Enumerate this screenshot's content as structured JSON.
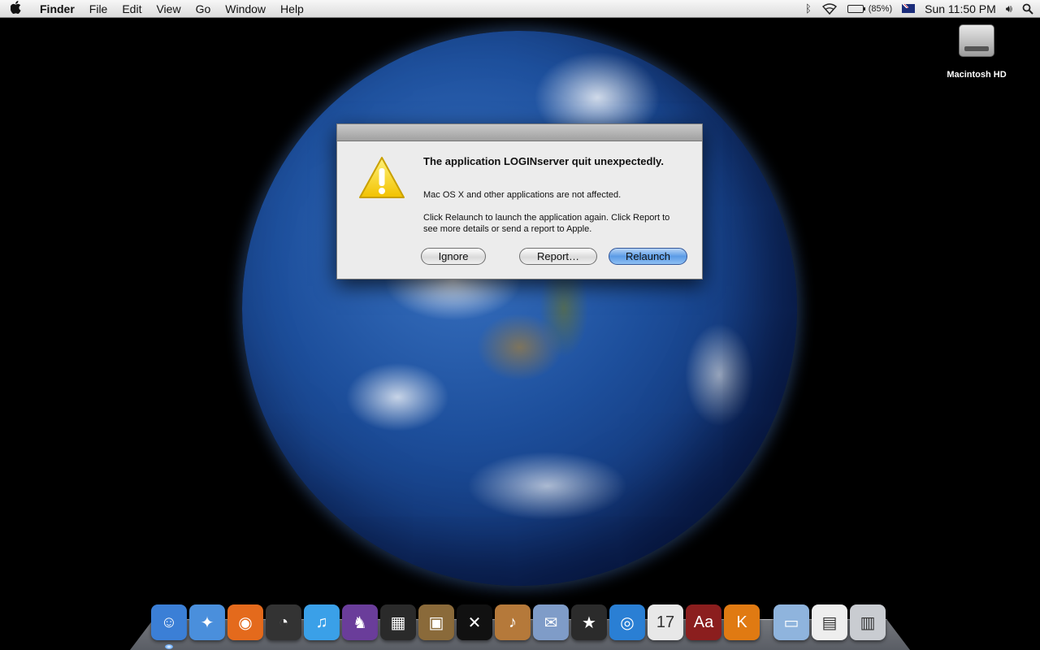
{
  "menubar": {
    "apple_icon": "apple-icon",
    "app_name": "Finder",
    "items": [
      "File",
      "Edit",
      "View",
      "Go",
      "Window",
      "Help"
    ],
    "battery_text": "(85%)",
    "battery_level": 0.85,
    "clock": "Sun 11:50 PM"
  },
  "desktop": {
    "hd_label": "Macintosh HD"
  },
  "dialog": {
    "title": "The application LOGINserver quit unexpectedly.",
    "message1": "Mac OS X and other applications are not affected.",
    "message2": "Click Relaunch to launch the application again. Click Report to see more details or send a report to Apple.",
    "ignore_label": "Ignore",
    "report_label": "Report…",
    "relaunch_label": "Relaunch"
  },
  "dock": {
    "items": [
      {
        "name": "finder-icon",
        "color": "#3b7fd6",
        "glyph": "☺"
      },
      {
        "name": "safari-icon",
        "color": "#4a8fdc",
        "glyph": "✦"
      },
      {
        "name": "firefox-icon",
        "color": "#e46a1c",
        "glyph": "◉"
      },
      {
        "name": "dashboard-icon",
        "color": "#333333",
        "glyph": "◔"
      },
      {
        "name": "itunes-icon",
        "color": "#3aa0e8",
        "glyph": "♫"
      },
      {
        "name": "adium-icon",
        "color": "#6a3d9a",
        "glyph": "♞"
      },
      {
        "name": "photo-booth-icon",
        "color": "#2a2a2a",
        "glyph": "▦"
      },
      {
        "name": "iphoto-icon",
        "color": "#8a6a3a",
        "glyph": "▣"
      },
      {
        "name": "front-row-icon",
        "color": "#111111",
        "glyph": "✕"
      },
      {
        "name": "garageband-icon",
        "color": "#b5793a",
        "glyph": "♪"
      },
      {
        "name": "mail-icon",
        "color": "#7f9cc8",
        "glyph": "✉"
      },
      {
        "name": "imovie-icon",
        "color": "#2b2b2b",
        "glyph": "★"
      },
      {
        "name": "dvd-player-icon",
        "color": "#2a7fd4",
        "glyph": "◎"
      },
      {
        "name": "ical-icon",
        "color": "#e8e8e8",
        "glyph": "17"
      },
      {
        "name": "dictionary-icon",
        "color": "#8b1e1e",
        "glyph": "Aa"
      },
      {
        "name": "komodo-icon",
        "color": "#e07a12",
        "glyph": "K"
      }
    ],
    "right_items": [
      {
        "name": "documents-folder-icon",
        "color": "#8fb4dd",
        "glyph": "▭"
      },
      {
        "name": "document-stack-icon",
        "color": "#eeeeee",
        "glyph": "▤"
      },
      {
        "name": "trash-icon",
        "color": "#c9ccd1",
        "glyph": "▥"
      }
    ]
  }
}
